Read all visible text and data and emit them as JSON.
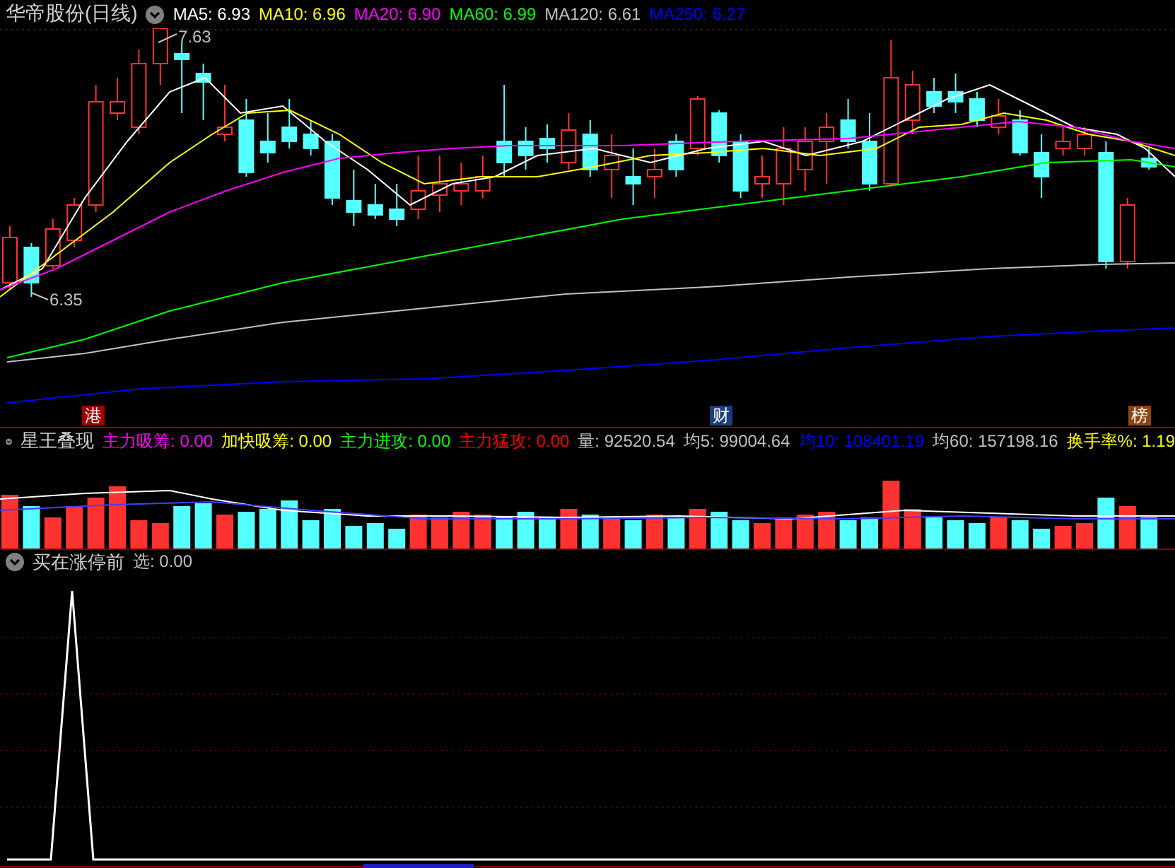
{
  "main_panel": {
    "title": "华帝股份(日线)",
    "ma_values": [
      {
        "label": "MA5: 6.93",
        "color": "#ffffff"
      },
      {
        "label": "MA10: 6.96",
        "color": "#ffff00"
      },
      {
        "label": "MA20: 6.90",
        "color": "#ff00ff"
      },
      {
        "label": "MA60: 6.99",
        "color": "#00ff00"
      },
      {
        "label": "MA120: 6.61",
        "color": "#c0c0c0"
      },
      {
        "label": "MA250: 6.27",
        "color": "#0000ff"
      }
    ],
    "high_label": "7.63",
    "low_label": "6.35",
    "event_markers": [
      {
        "text": "港",
        "color": "#a00000"
      },
      {
        "text": "财",
        "color": "#1a3f7a"
      },
      {
        "text": "榜",
        "color": "#8b4513"
      }
    ]
  },
  "indicator_panel": {
    "title": "星王叠现",
    "values": [
      {
        "label": "主力吸筹: 0.00",
        "color": "#ff00ff"
      },
      {
        "label": "加快吸筹: 0.00",
        "color": "#ffff00"
      },
      {
        "label": "主力进攻: 0.00",
        "color": "#00ff00"
      },
      {
        "label": "主力猛攻: 0.00",
        "color": "#ff0000"
      },
      {
        "label": "量: 92520.54",
        "color": "#c0c0c0"
      },
      {
        "label": "均5: 99004.64",
        "color": "#c0c0c0"
      },
      {
        "label": "均10: 108401.19",
        "color": "#0000ff"
      },
      {
        "label": "均60: 157198.16",
        "color": "#c0c0c0"
      },
      {
        "label": "换手率%: 1.19",
        "color": "#ffff00"
      }
    ]
  },
  "signal_panel": {
    "title": "买在涨停前",
    "values": [
      {
        "label": "选: 0.00",
        "color": "#c0c0c0"
      }
    ]
  }
}
